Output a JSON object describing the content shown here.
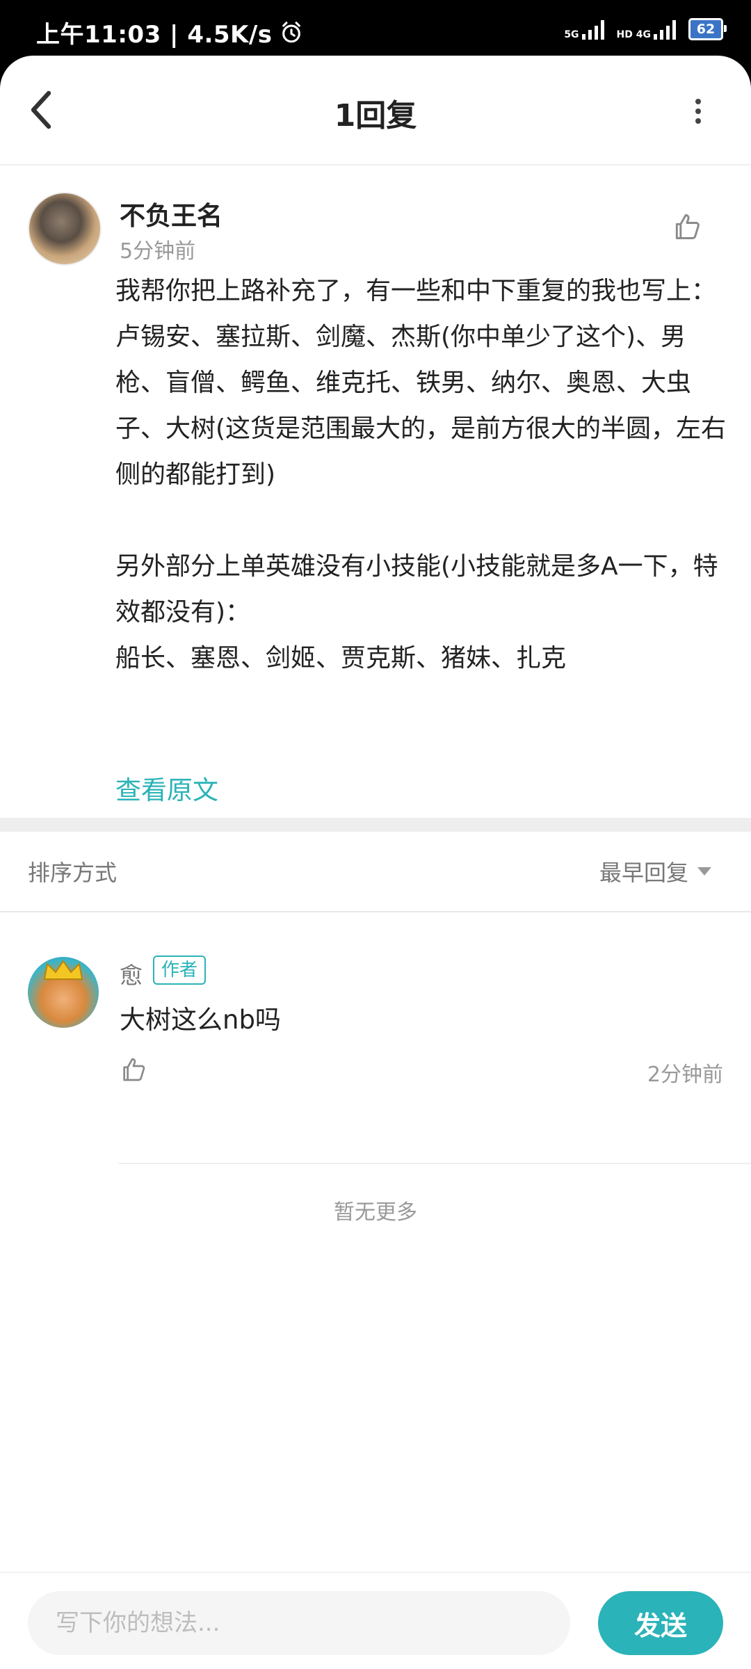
{
  "status_bar": {
    "time": "上午11:03 | 4.5K/s",
    "signal1_label": "5G",
    "signal2_label": "HD 4G",
    "battery": "62"
  },
  "header": {
    "title": "1回复"
  },
  "post": {
    "author": "不负王名",
    "time": "5分钟前",
    "lines": [
      "我帮你把上路补充了，有一些和中下重复的我也写上：",
      "卢锡安、塞拉斯、剑魔、杰斯(你中单少了这个)、男枪、盲僧、鳄鱼、维克托、铁男、纳尔、奥恩、大虫子、大树(这货是范围最大的，是前方很大的半圆，左右侧的都能打到)",
      "",
      "另外部分上单英雄没有小技能(小技能就是多A一下，特效都没有)：",
      "船长、塞恩、剑姬、贾克斯、猪妹、扎克"
    ],
    "view_original": "查看原文"
  },
  "sort": {
    "label": "排序方式",
    "value": "最早回复"
  },
  "reply": {
    "author": "愈",
    "badge": "作者",
    "text": "大树这么nb吗",
    "time": "2分钟前"
  },
  "footer": {
    "no_more": "暂无更多"
  },
  "compose": {
    "placeholder": "写下你的想法...",
    "send_label": "发送"
  },
  "colors": {
    "accent": "#2ab3b8"
  }
}
